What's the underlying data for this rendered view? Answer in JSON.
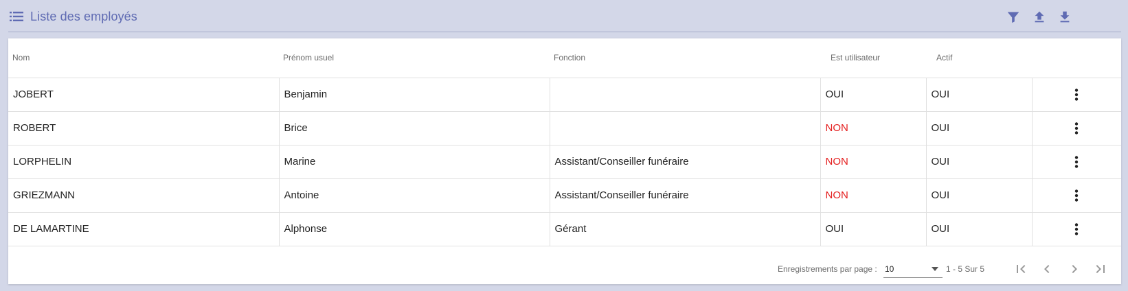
{
  "header": {
    "title": "Liste des employés",
    "icons": [
      "list-icon",
      "filter-icon",
      "upload-icon",
      "download-icon"
    ],
    "accent_color": "#5f6bb3"
  },
  "table": {
    "columns": [
      "Nom",
      "Prénom usuel",
      "Fonction",
      "Est utilisateur",
      "Actif"
    ],
    "rows": [
      {
        "nom": "JOBERT",
        "prenom": "Benjamin",
        "fonction": "",
        "utilisateur": "OUI",
        "actif": "OUI"
      },
      {
        "nom": "ROBERT",
        "prenom": "Brice",
        "fonction": "",
        "utilisateur": "NON",
        "actif": "OUI"
      },
      {
        "nom": "LORPHELIN",
        "prenom": "Marine",
        "fonction": "Assistant/Conseiller funéraire",
        "utilisateur": "NON",
        "actif": "OUI"
      },
      {
        "nom": "GRIEZMANN",
        "prenom": "Antoine",
        "fonction": "Assistant/Conseiller funéraire",
        "utilisateur": "NON",
        "actif": "OUI"
      },
      {
        "nom": "DE LAMARTINE",
        "prenom": "Alphonse",
        "fonction": "Gérant",
        "utilisateur": "OUI",
        "actif": "OUI"
      }
    ],
    "negative_color": "#e41d1d",
    "row_action_icon": "more-vertical-icon"
  },
  "pagination": {
    "per_page_label": "Enregistrements par page :",
    "per_page_value": "10",
    "range": "1 - 5 Sur 5",
    "icons": [
      "first-page-icon",
      "prev-page-icon",
      "next-page-icon",
      "last-page-icon"
    ]
  }
}
